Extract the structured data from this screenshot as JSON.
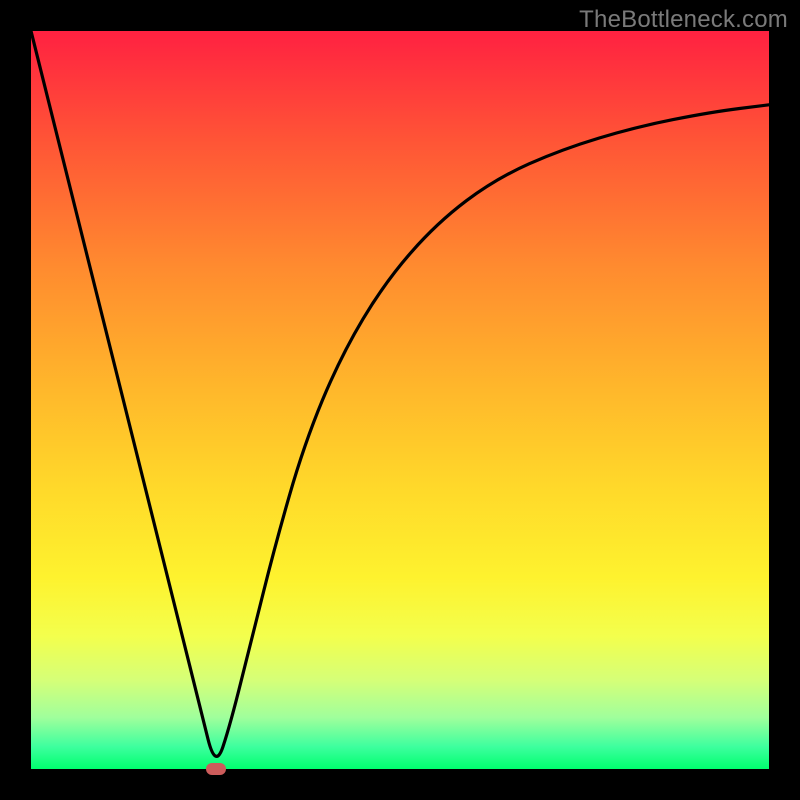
{
  "watermark": "TheBottleneck.com",
  "chart_data": {
    "type": "line",
    "title": "",
    "xlabel": "",
    "ylabel": "",
    "xlim": [
      0,
      100
    ],
    "ylim": [
      0,
      100
    ],
    "legend": false,
    "grid": false,
    "background_gradient": {
      "direction": "vertical",
      "stops": [
        {
          "pos": 0.0,
          "color": "#ff2141"
        },
        {
          "pos": 0.15,
          "color": "#ff5536"
        },
        {
          "pos": 0.32,
          "color": "#ff8b2f"
        },
        {
          "pos": 0.48,
          "color": "#ffb62b"
        },
        {
          "pos": 0.62,
          "color": "#ffd92a"
        },
        {
          "pos": 0.74,
          "color": "#fef22e"
        },
        {
          "pos": 0.82,
          "color": "#f3ff4d"
        },
        {
          "pos": 0.88,
          "color": "#d5ff78"
        },
        {
          "pos": 0.93,
          "color": "#a0ff9c"
        },
        {
          "pos": 0.97,
          "color": "#3dff9e"
        },
        {
          "pos": 1.0,
          "color": "#00ff6e"
        }
      ]
    },
    "series": [
      {
        "name": "bottleneck-curve",
        "color": "#000000",
        "x": [
          0,
          5,
          10,
          15,
          20,
          23,
          25,
          27,
          30,
          33,
          37,
          42,
          48,
          55,
          63,
          72,
          82,
          92,
          100
        ],
        "y": [
          100,
          80,
          60,
          40,
          20,
          8,
          0,
          6,
          18,
          30,
          44,
          56,
          66,
          74,
          80,
          84,
          87,
          89,
          90
        ]
      }
    ],
    "marker": {
      "name": "bottleneck-point",
      "x": 25,
      "y": 0,
      "color": "#cc5c5b"
    }
  }
}
